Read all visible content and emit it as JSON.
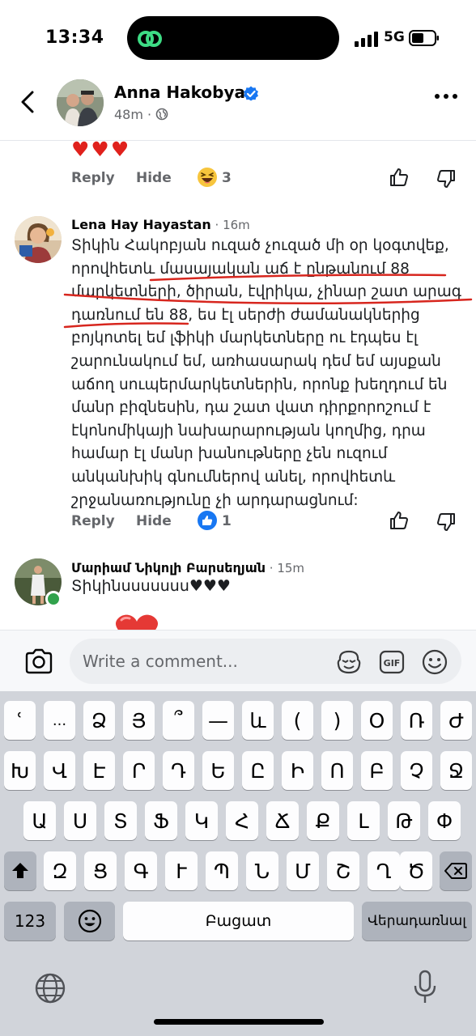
{
  "status_bar": {
    "time": "13:34",
    "network": "5G"
  },
  "header": {
    "name": "Anna Hakobyan",
    "meta": "48m ·"
  },
  "prev_comment": {
    "emoji": "♥♥♥",
    "reply": "Reply",
    "hide": "Hide",
    "reaction_count": "3"
  },
  "comment1": {
    "author": "Lena Hay Hayastan",
    "time": " · 16m",
    "lines": [
      "Տիկին Հակոբյան ուզած չուզած մի օր կօգտվեք,",
      "որովհետև մասայական աճ է ընթանում 88",
      "մարկետների, ծիրան, էվրիկա, չինար շատ արագ",
      "դառնում են 88, ես էլ սերժի ժամանակներից",
      "բոյկոտել եմ լֆիկի մարկետները ու էդպես էլ",
      "շարունակում եմ, առհասարակ դեմ եմ այսքան",
      "աճող սուպերմարկետներին, որոնք խեղդում են",
      "մանր բիզնեսին, դա շատ վատ դիրքորոշում է",
      "էկոնոմիկայի նախարարության կողմից, դրա",
      "համար էլ մանր խանութները չեն ուզում",
      "անկանխիկ գնումներով անել, որովհետև",
      "շրջանառությունը չի արդարացնում:"
    ],
    "reply": "Reply",
    "hide": "Hide",
    "reaction_count": "1"
  },
  "comment2": {
    "author": "Մարիամ Նիկոլի Բարսեղյան",
    "time": " · 15m",
    "text": "Տիկինսսսսսսս♥♥♥"
  },
  "composer": {
    "placeholder": "Write a comment..."
  },
  "keyboard": {
    "row1": [
      "ՙ",
      "...",
      "Ձ",
      "Յ",
      "՞",
      "—",
      "և",
      "(",
      ")",
      "Օ",
      "Ռ",
      "Ժ"
    ],
    "row2": [
      "Խ",
      "Վ",
      "Է",
      "Ր",
      "Դ",
      "Ե",
      "Ը",
      "Ի",
      "Ո",
      "Բ",
      "Չ",
      "Ջ"
    ],
    "row3": [
      "Ա",
      "Ս",
      "Տ",
      "Ֆ",
      "Կ",
      "Հ",
      "Ճ",
      "Ք",
      "Լ",
      "Թ",
      "Փ"
    ],
    "row4": [
      "Զ",
      "Ց",
      "Գ",
      "Ւ",
      "Պ",
      "Ն",
      "Մ",
      "Շ",
      "Ղ",
      "Ծ"
    ],
    "numbers": "123",
    "space": "Բացատ",
    "return": "Վերադառնալ"
  },
  "colors": {
    "accent_blue": "#1877f2",
    "heart_red": "#e0211c",
    "annotation_red": "#d7261e"
  }
}
